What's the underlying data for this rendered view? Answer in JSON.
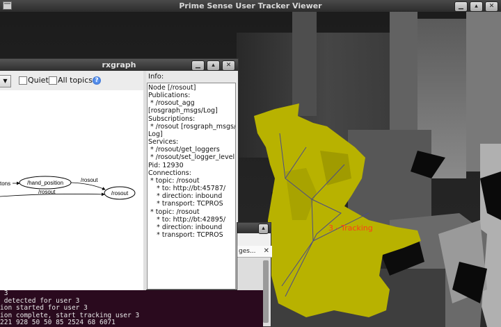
{
  "viewer": {
    "title": "Prime Sense User Tracker Viewer",
    "tracking_label": "3 - Tracking",
    "tracking_color": "#ff3c1a",
    "user_color": "#b8b200"
  },
  "rxgraph": {
    "title": "rxgraph",
    "toolbar": {
      "quiet_label": "Quiet",
      "all_topics_label": "All topics",
      "help_symbol": "?"
    },
    "graph": {
      "nodes": [
        "/hand_position",
        "/rosout"
      ],
      "edges": [
        "/rosout",
        "/rosout"
      ],
      "cut_label": "tons"
    },
    "info_label": "Info:",
    "info_lines": [
      "Node [/rosout]",
      "Publications:",
      " * /rosout_agg",
      "[rosgraph_msgs/Log]",
      "",
      "Subscriptions:",
      " * /rosout [rosgraph_msgs/",
      "Log]",
      "",
      "Services:",
      " * /rosout/get_loggers",
      " * /rosout/set_logger_level",
      "Pid: 12930",
      "Connections:",
      " * topic: /rosout",
      "    * to: http://bt:45787/",
      "    * direction: inbound",
      "    * transport: TCPROS",
      " * topic: /rosout",
      "    * to: http://bt:42895/",
      "    * direction: inbound",
      "    * transport: TCPROS"
    ]
  },
  "small_window": {
    "tab_label": "ges...",
    "close_symbol": "✕"
  },
  "terminal": {
    "lines": [
      " 3",
      " detected for user 3",
      "ion started for user 3",
      "ion complete, start tracking user 3",
      "221 928 50 50 85 2524 68 6071"
    ]
  }
}
